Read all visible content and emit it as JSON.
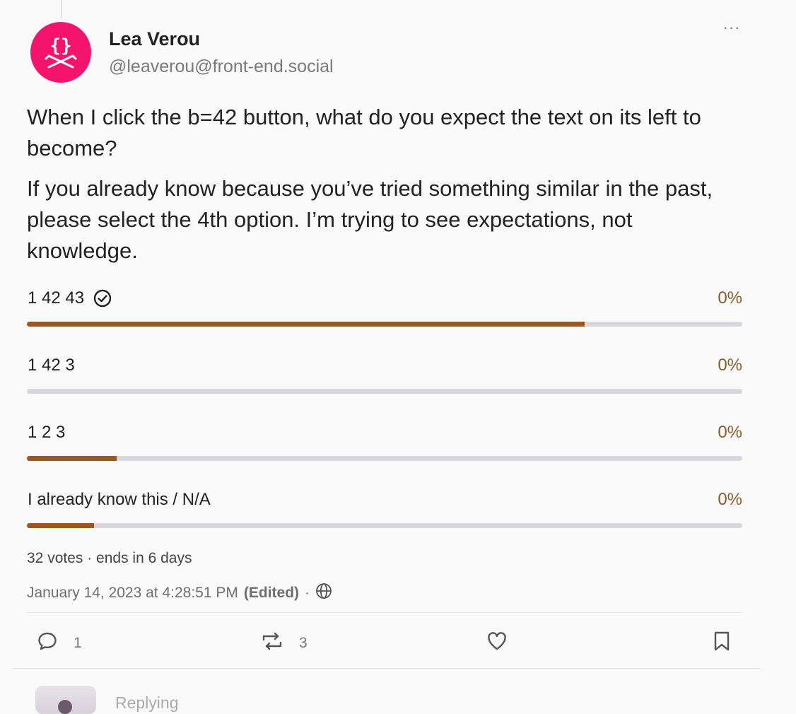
{
  "author": {
    "display_name": "Lea Verou",
    "handle": "@leaverou@front-end.social",
    "avatar_glyph": "{}"
  },
  "status": {
    "paragraphs": [
      "When I click the b=42 button, what do you expect the text on its left to become?",
      "If you already know because you’ve tried something similar in the past, please select the 4th option. I’m trying to see expectations, not knowledge."
    ]
  },
  "poll": {
    "options": [
      {
        "label": "1 42 43",
        "percent": "0%",
        "fill": 0.78,
        "voted": true
      },
      {
        "label": "1 42 3",
        "percent": "0%",
        "fill": 0.0,
        "voted": false
      },
      {
        "label": "1 2 3",
        "percent": "0%",
        "fill": 0.125,
        "voted": false
      },
      {
        "label": "I already know this / N/A",
        "percent": "0%",
        "fill": 0.094,
        "voted": false
      }
    ],
    "footer": "32 votes · ends in 6 days"
  },
  "meta": {
    "timestamp": "January 14, 2023 at 4:28:51 PM",
    "edited": "(Edited)",
    "separator": "·",
    "visibility_icon": "globe-icon"
  },
  "actions": {
    "reply_count": "1",
    "boost_count": "3",
    "reply_icon": "reply-icon",
    "boost_icon": "boost-icon",
    "favourite_icon": "heart-icon",
    "bookmark_icon": "bookmark-icon",
    "more_label": "···"
  },
  "next_item": {
    "label": "Replying"
  },
  "colors": {
    "avatar_bg": "#f5146d",
    "poll_fill": "#9c5622",
    "poll_track": "#d8d8dc",
    "percent_text": "#8b5a2b"
  }
}
